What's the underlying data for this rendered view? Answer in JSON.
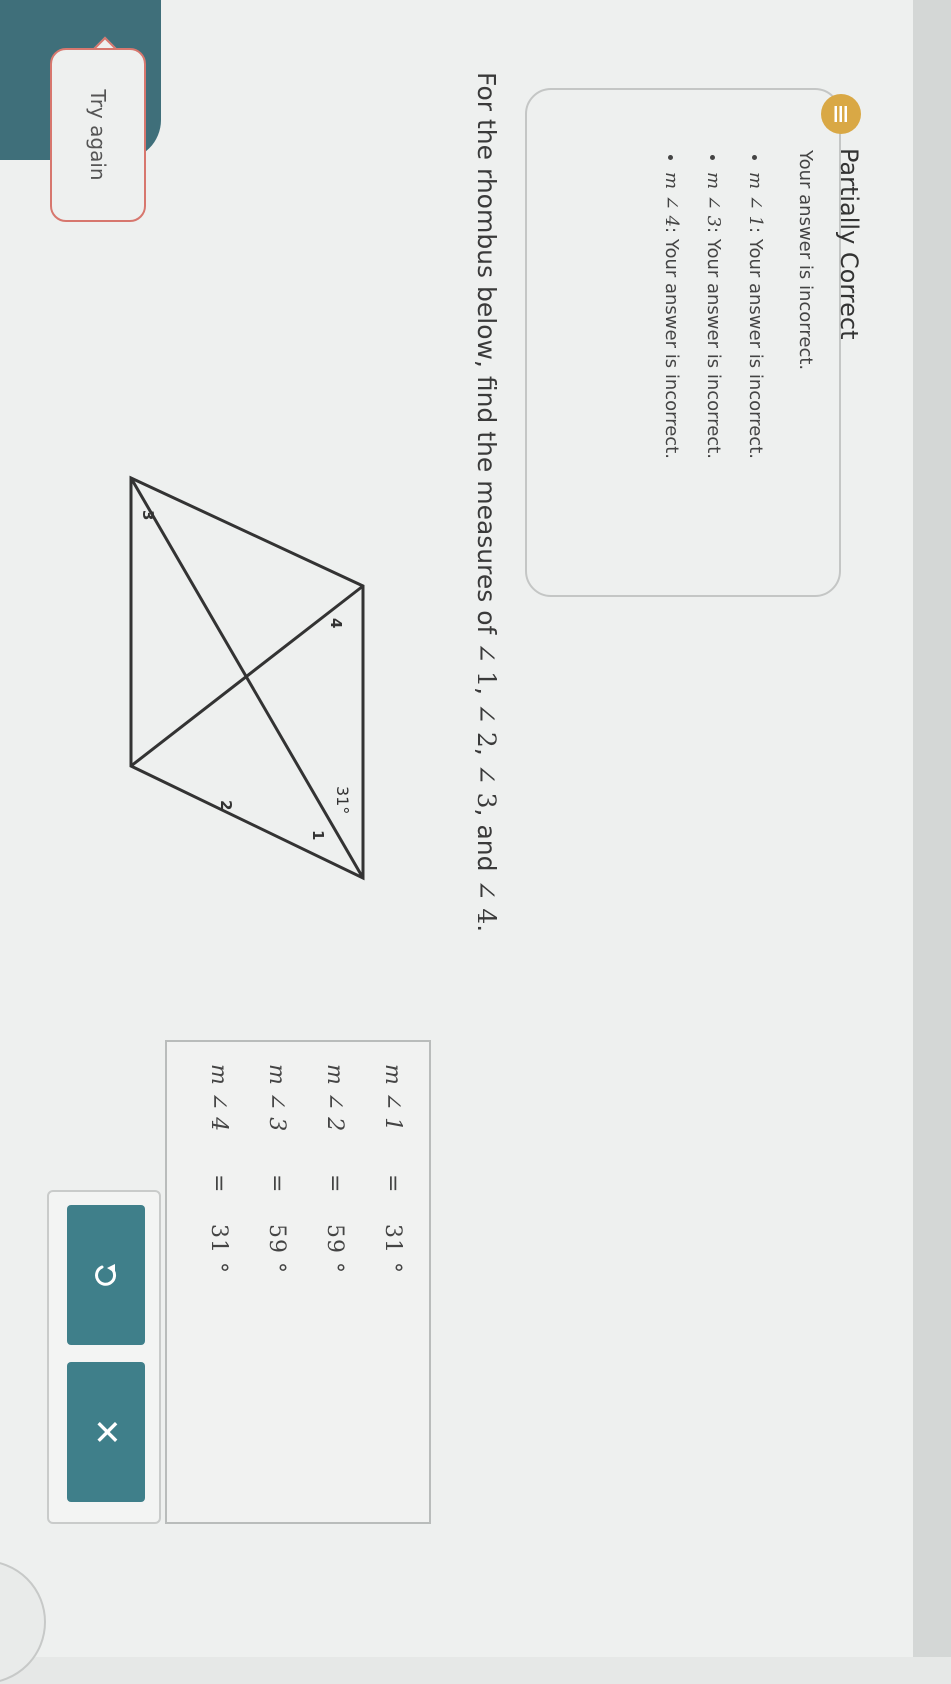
{
  "feedback": {
    "title": "Partially Correct",
    "summary": "Your answer is incorrect.",
    "items": [
      {
        "label": "m ∠ 1",
        "text": ": Your answer is incorrect."
      },
      {
        "label": "m ∠ 3",
        "text": ": Your answer is incorrect."
      },
      {
        "label": "m ∠ 4",
        "text": ": Your answer is incorrect."
      }
    ]
  },
  "question": {
    "text": "For the rhombus below, find the measures of",
    "angles": [
      "∠ 1",
      "∠ 2",
      "∠ 3",
      "∠ 4"
    ],
    "sep": ",",
    "and": "and",
    "end": "."
  },
  "figure": {
    "given_angle": "31°",
    "labels": [
      "1",
      "2",
      "3",
      "4"
    ]
  },
  "answers": [
    {
      "label": "m ∠ 1",
      "eq": "=",
      "value": "31",
      "unit": "°"
    },
    {
      "label": "m ∠ 2",
      "eq": "=",
      "value": "59",
      "unit": "°"
    },
    {
      "label": "m ∠ 3",
      "eq": "=",
      "value": "59",
      "unit": "°"
    },
    {
      "label": "m ∠ 4",
      "eq": "=",
      "value": "31",
      "unit": "°"
    }
  ],
  "actions": {
    "try_again": "Try again",
    "undo_icon": "undo-icon",
    "close_icon": "close-icon",
    "close_glyph": "✕"
  },
  "colors": {
    "teal": "#3f7f8a",
    "feedback_icon": "#d9a845",
    "try_again_border": "#d7776e"
  }
}
